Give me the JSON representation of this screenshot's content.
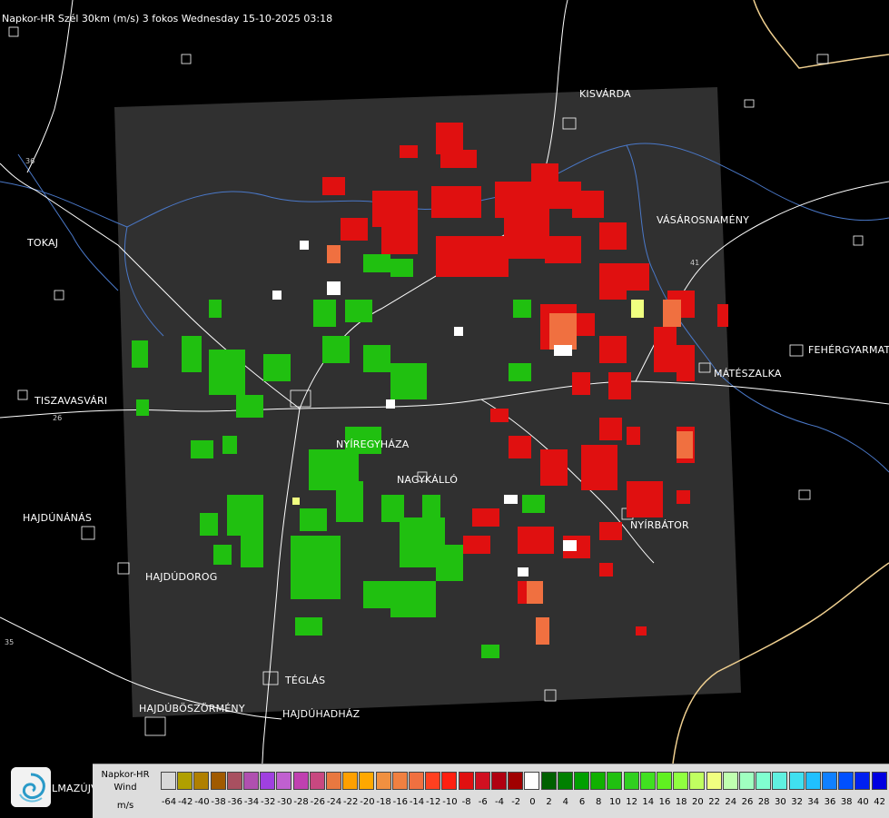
{
  "title": "Napkor-HR Szél 30km (m/s) 3 fokos Wednesday 15-10-2025 03:18",
  "cities": [
    {
      "name": "KISVÁRDA",
      "id": "kisvarda"
    },
    {
      "name": "VÁSÁROSNAMÉNY",
      "id": "vasarosnameny"
    },
    {
      "name": "TOKAJ",
      "id": "tokaj"
    },
    {
      "name": "FEHÉRGYARMAT",
      "id": "fehergyarmat"
    },
    {
      "name": "MÁTÉSZALKA",
      "id": "mateszalka"
    },
    {
      "name": "TISZAVASVÁRI",
      "id": "tiszavasvari"
    },
    {
      "name": "NYÍREGYHÁZA",
      "id": "nyiregyhaza"
    },
    {
      "name": "NAGYKÁLLÓ",
      "id": "nagykallo"
    },
    {
      "name": "HAJDÚNÁNÁS",
      "id": "hajdunanas"
    },
    {
      "name": "NYÍRBÁTOR",
      "id": "nyirbator"
    },
    {
      "name": "HAJDÚDOROG",
      "id": "hajdudorog"
    },
    {
      "name": "TÉGLÁS",
      "id": "teglas"
    },
    {
      "name": "HAJDÚBÖSZÖRMÉNY",
      "id": "hajduboszormeny"
    },
    {
      "name": "HAJDÚHADHÁZ",
      "id": "hajduhadhaz"
    },
    {
      "name": "LMAZÚJVÁR",
      "id": "lmazujvar"
    }
  ],
  "road_numbers": [
    "36",
    "26",
    "35",
    "41"
  ],
  "legend": {
    "caption": [
      "Napkor-HR",
      "Wind",
      "m/s"
    ],
    "ticks": [
      "-64",
      "-42",
      "-40",
      "-38",
      "-36",
      "-34",
      "-32",
      "-30",
      "-28",
      "-26",
      "-24",
      "-22",
      "-20",
      "-18",
      "-16",
      "-14",
      "-12",
      "-10",
      "-8",
      "-6",
      "-4",
      "-2",
      "0",
      "2",
      "4",
      "6",
      "8",
      "10",
      "12",
      "14",
      "16",
      "18",
      "20",
      "22",
      "24",
      "26",
      "28",
      "30",
      "32",
      "34",
      "36",
      "38",
      "40",
      "42"
    ],
    "colors": [
      "#d8d8d8",
      "#b0a000",
      "#b08000",
      "#a05a00",
      "#a85060",
      "#b050b0",
      "#a040e0",
      "#c060d0",
      "#c040b0",
      "#c84880",
      "#e87840",
      "#ffa000",
      "#ffa800",
      "#f09040",
      "#f08040",
      "#f07040",
      "#ff4020",
      "#ff2010",
      "#e01010",
      "#d01020",
      "#b00010",
      "#a00000",
      "#ffffff",
      "#006000",
      "#008000",
      "#00a000",
      "#10b000",
      "#20c010",
      "#30d020",
      "#40e020",
      "#60f020",
      "#90ff40",
      "#c0ff60",
      "#f0ff80",
      "#c0ffb0",
      "#a0ffc0",
      "#80ffd0",
      "#60f0e0",
      "#40e0f0",
      "#20c0ff",
      "#1080ff",
      "#0050ff",
      "#0020f0",
      "#0000e0"
    ]
  },
  "palette": {
    "background": "#000000",
    "radar_area": "#303030",
    "borders": "#ffffff",
    "rivers": "#4a78c8",
    "country_border": "#f0d090"
  },
  "icons": {
    "logo": "swirl-logo-icon"
  }
}
